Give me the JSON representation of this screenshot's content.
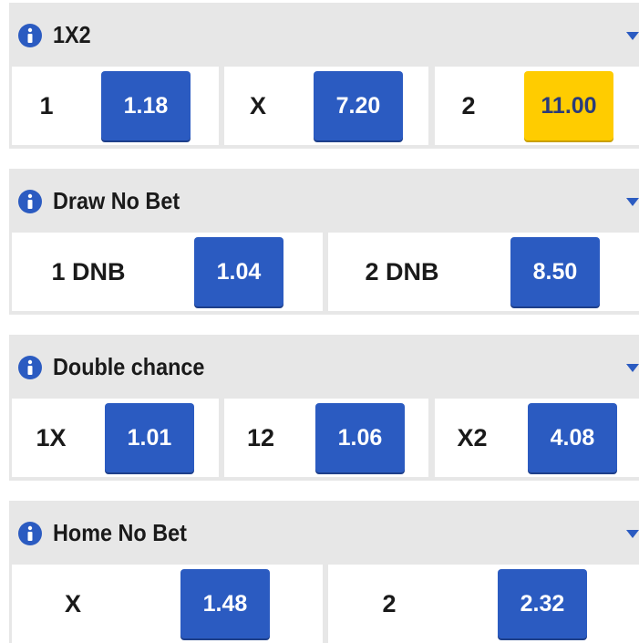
{
  "colors": {
    "odds_button": "#2b5bc1",
    "odds_button_highlight": "#ffcc00",
    "header_background": "#e7e7e7",
    "info_icon": "#2b5bc1"
  },
  "icons": {
    "info": "info-icon",
    "collapse": "chevron-down-icon"
  },
  "markets": [
    {
      "title": "1X2",
      "selections": [
        {
          "label": "1",
          "odds": "1.18",
          "selected": false
        },
        {
          "label": "X",
          "odds": "7.20",
          "selected": false
        },
        {
          "label": "2",
          "odds": "11.00",
          "selected": true
        }
      ]
    },
    {
      "title": "Draw No Bet",
      "selections": [
        {
          "label": "1 DNB",
          "odds": "1.04",
          "selected": false
        },
        {
          "label": "2 DNB",
          "odds": "8.50",
          "selected": false
        }
      ]
    },
    {
      "title": "Double chance",
      "selections": [
        {
          "label": "1X",
          "odds": "1.01",
          "selected": false
        },
        {
          "label": "12",
          "odds": "1.06",
          "selected": false
        },
        {
          "label": "X2",
          "odds": "4.08",
          "selected": false
        }
      ]
    },
    {
      "title": "Home No Bet",
      "selections": [
        {
          "label": "X",
          "odds": "1.48",
          "selected": false
        },
        {
          "label": "2",
          "odds": "2.32",
          "selected": false
        }
      ]
    }
  ]
}
